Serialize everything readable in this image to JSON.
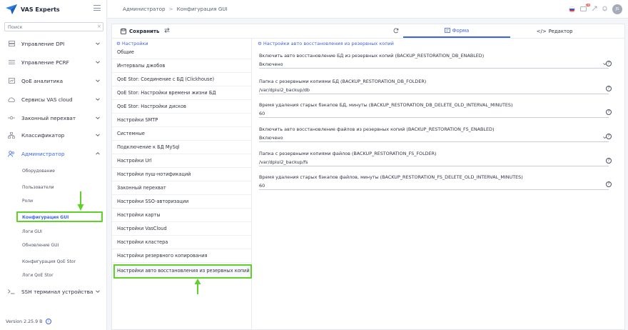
{
  "brand": {
    "name": "VAS Experts"
  },
  "search": {
    "placeholder": "Поиск",
    "clear": "×"
  },
  "nav": [
    {
      "label": "Управление DPI",
      "icon": "server-icon"
    },
    {
      "label": "Управление PCRF",
      "icon": "server-stack-icon"
    },
    {
      "label": "QoE аналитика",
      "icon": "chart-icon"
    },
    {
      "label": "Сервисы VAS cloud",
      "icon": "cloud-icon"
    },
    {
      "label": "Законный перехват",
      "icon": "intercept-icon"
    },
    {
      "label": "Классификатор",
      "icon": "hierarchy-icon"
    },
    {
      "label": "Администратор",
      "icon": "users-icon"
    },
    {
      "label": "SSH терминал устройства",
      "icon": "terminal-icon"
    }
  ],
  "admin_sub": [
    "Оборудование",
    "Пользователи",
    "Роли",
    "Конфигурация GUI",
    "Логи GUI",
    "Обновление GUI",
    "Конфигурация QoE Stor",
    "Логи QoE Stor"
  ],
  "version": "Version 2.25.9 B",
  "breadcrumb": {
    "root": "Администратор",
    "current": "Конфигурация GUI",
    "sep": ">"
  },
  "topbar": {
    "avatar": "JS",
    "notif_badge": "28"
  },
  "toolbar": {
    "save_label": "Сохранить"
  },
  "tabs": {
    "form": "Форма",
    "editor": "Редактор"
  },
  "settings": {
    "header": "Настройки",
    "items": [
      "Общие",
      "Интервалы джобов",
      "QoE Stor: Соединение с БД (Clickhouse)",
      "QoE Stor: Настройки времени жизни БД",
      "QoE Stor: Настройки дисков",
      "Настройки SMTP",
      "Системные",
      "Подключение к БД MySql",
      "Настройки Url",
      "Настройки пуш-нотификаций",
      "Законный перехват",
      "Настройки SSO-авторизации",
      "Настройки карты",
      "Настройки VasCloud",
      "Настройки кластера",
      "Настройки резервного копирования",
      "Настройки авто восстановления из резервных копий"
    ]
  },
  "form": {
    "header": "Настройки авто восстановления из резервных копий",
    "help": "?",
    "fields": [
      {
        "label": "Включить авто восстановление БД из резервных копий (BACKUP_RESTORATION_DB_ENABLED)",
        "value": "Включено",
        "type": "select"
      },
      {
        "label": "Папка с резервными копиями БД (BACKUP_RESTORATION_DB_FOLDER)",
        "value": "/var/dpiui2_backup/db",
        "type": "text"
      },
      {
        "label": "Время удаления старых бэкапов БД, минуты (BACKUP_RESTORATION_DB_DELETE_OLD_INTERVAL_MINUTES)",
        "value": "60",
        "type": "text"
      },
      {
        "label": "Включить авто восстановление файлов из резервных копий (BACKUP_RESTORATION_FS_ENABLED)",
        "value": "Включено",
        "type": "select"
      },
      {
        "label": "Папка с резервными копиями файлов (BACKUP_RESTORATION_FS_FOLDER)",
        "value": "/var/dpiui2_backup/fs",
        "type": "text"
      },
      {
        "label": "Время удаления старых бэкапов файлов, минуты (BACKUP_RESTORATION_FS_DELETE_OLD_INTERVAL_MINUTES)",
        "value": "60",
        "type": "text"
      }
    ]
  },
  "colors": {
    "accent": "#3f63e8",
    "highlight": "#5fd12a"
  }
}
